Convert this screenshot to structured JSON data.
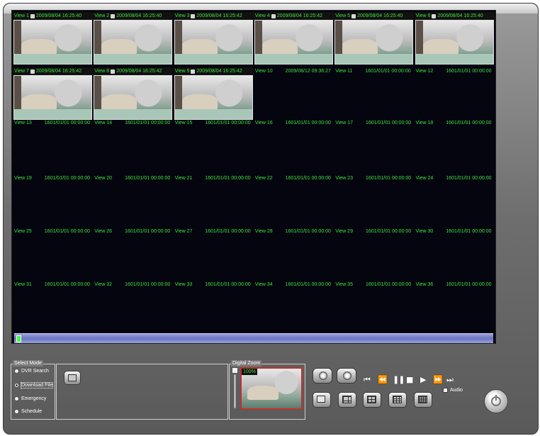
{
  "views": [
    {
      "label": "View 1",
      "time": "2009/08/04 16:25:40",
      "active": true
    },
    {
      "label": "View 2",
      "time": "2009/08/04 16:25:40",
      "active": true
    },
    {
      "label": "View 3",
      "time": "2009/08/04 16:25:42",
      "active": true
    },
    {
      "label": "View 4",
      "time": "2009/08/04 16:25:42",
      "active": true
    },
    {
      "label": "View 5",
      "time": "2009/08/04 16:25:40",
      "active": true
    },
    {
      "label": "View 6",
      "time": "2009/08/04 16:25:40",
      "active": true
    },
    {
      "label": "View 7",
      "time": "2009/08/04 16:25:42",
      "active": true
    },
    {
      "label": "View 8",
      "time": "2009/08/04 16:25:42",
      "active": true
    },
    {
      "label": "View 9",
      "time": "2009/08/04 16:25:42",
      "active": true
    },
    {
      "label": "View 10",
      "time": "2009/08/12 09:36:27",
      "active": false
    },
    {
      "label": "View 11",
      "time": "1601/01/01 00:00:00",
      "active": false
    },
    {
      "label": "View 12",
      "time": "1601/01/01 00:00:00",
      "active": false
    },
    {
      "label": "View 13",
      "time": "1601/01/01 00:00:00",
      "active": false
    },
    {
      "label": "View 14",
      "time": "1601/01/01 00:00:00",
      "active": false
    },
    {
      "label": "View 15",
      "time": "1601/01/01 00:00:00",
      "active": false
    },
    {
      "label": "View 16",
      "time": "1601/01/01 00:00:00",
      "active": false
    },
    {
      "label": "View 17",
      "time": "1601/01/01 00:00:00",
      "active": false
    },
    {
      "label": "View 18",
      "time": "1601/01/01 00:00:00",
      "active": false
    },
    {
      "label": "View 19",
      "time": "1601/01/01 00:00:00",
      "active": false
    },
    {
      "label": "View 20",
      "time": "1601/01/01 00:00:00",
      "active": false
    },
    {
      "label": "View 21",
      "time": "1601/01/01 00:00:00",
      "active": false
    },
    {
      "label": "View 22",
      "time": "1601/01/01 00:00:00",
      "active": false
    },
    {
      "label": "View 23",
      "time": "1601/01/01 00:00:00",
      "active": false
    },
    {
      "label": "View 24",
      "time": "1601/01/01 00:00:00",
      "active": false
    },
    {
      "label": "View 25",
      "time": "1601/01/01 00:00:00",
      "active": false
    },
    {
      "label": "View 26",
      "time": "1601/01/01 00:00:00",
      "active": false
    },
    {
      "label": "View 27",
      "time": "1601/01/01 00:00:00",
      "active": false
    },
    {
      "label": "View 28",
      "time": "1601/01/01 00:00:00",
      "active": false
    },
    {
      "label": "View 29",
      "time": "1601/01/01 00:00:00",
      "active": false
    },
    {
      "label": "View 30",
      "time": "1601/01/01 00:00:00",
      "active": false
    },
    {
      "label": "View 31",
      "time": "1601/01/01 00:00:00",
      "active": false
    },
    {
      "label": "View 32",
      "time": "1601/01/01 00:00:00",
      "active": false
    },
    {
      "label": "View 33",
      "time": "1601/01/01 00:00:00",
      "active": false
    },
    {
      "label": "View 34",
      "time": "1601/01/01 00:00:00",
      "active": false
    },
    {
      "label": "View 35",
      "time": "1601/01/01 00:00:00",
      "active": false
    },
    {
      "label": "View 36",
      "time": "1601/01/01 00:00:00",
      "active": false
    }
  ],
  "select_mode": {
    "title": "Select Mode",
    "options": [
      {
        "label": "DVR Search",
        "checked": false
      },
      {
        "label": "Download File",
        "checked": true
      },
      {
        "label": "Emergency",
        "checked": false
      },
      {
        "label": "Schedule",
        "checked": false
      }
    ]
  },
  "digital_zoom": {
    "title": "Digital Zoom",
    "level": "100%"
  },
  "playback": {
    "prev_segment": "⏮",
    "rewind": "⏪",
    "pause": "❚❚",
    "stop": "■",
    "step": "▶",
    "fast_forward": "⏩",
    "next_segment": "⏭"
  },
  "audio": {
    "label": "Audio",
    "checked": false
  },
  "colors": {
    "overlay_text": "#3fe43f",
    "video_bg": "#05050f",
    "timeline": "#6c74c2"
  }
}
